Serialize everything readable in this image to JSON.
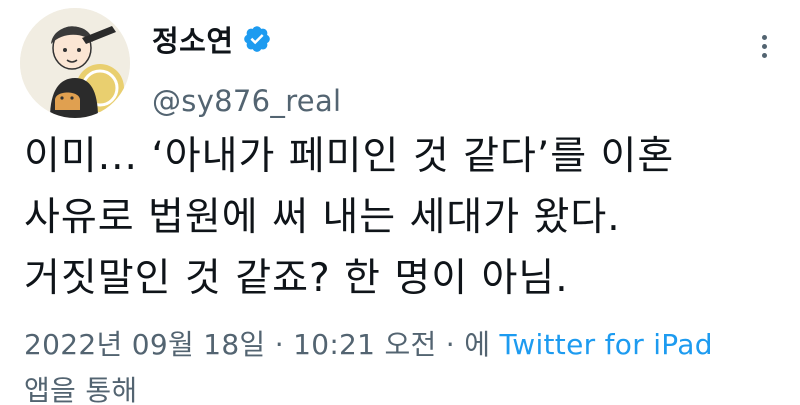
{
  "author": {
    "display_name": "정소연",
    "handle": "@sy876_real",
    "verified_icon": "verified-badge-icon",
    "avatar": "cartoon-avatar"
  },
  "tweet": {
    "lines": [
      "이미... ‘아내가 페미인 것 같다’를 이혼",
      "사유로 법원에 써 내는 세대가 왔다.",
      "거짓말인 것 같죠? 한 명이 아님."
    ]
  },
  "meta": {
    "timestamp": "2022년 09월 18일 · 10:21 오전 · 에",
    "source": "Twitter for iPad",
    "suffix": "앱을 통해"
  },
  "more_icon": "more-options-icon",
  "colors": {
    "accent": "#1d9bf0",
    "text": "#0f1419",
    "secondary": "#536471"
  }
}
